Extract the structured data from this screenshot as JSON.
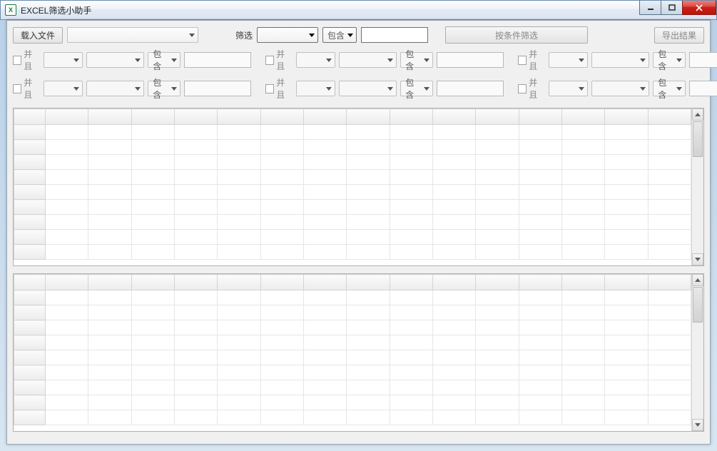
{
  "window": {
    "title": "EXCEL筛选小助手",
    "icon_letter": "X"
  },
  "toolbar": {
    "load_file": "载入文件",
    "filter_label": "筛选",
    "contain_label": "包含",
    "filter_button": "按条件筛选",
    "export_button": "导出结果"
  },
  "subfilter": {
    "and_label": "并且",
    "contain_label": "包含"
  },
  "grids": {
    "cols": 15,
    "top_rows": 9,
    "bottom_rows": 9
  }
}
